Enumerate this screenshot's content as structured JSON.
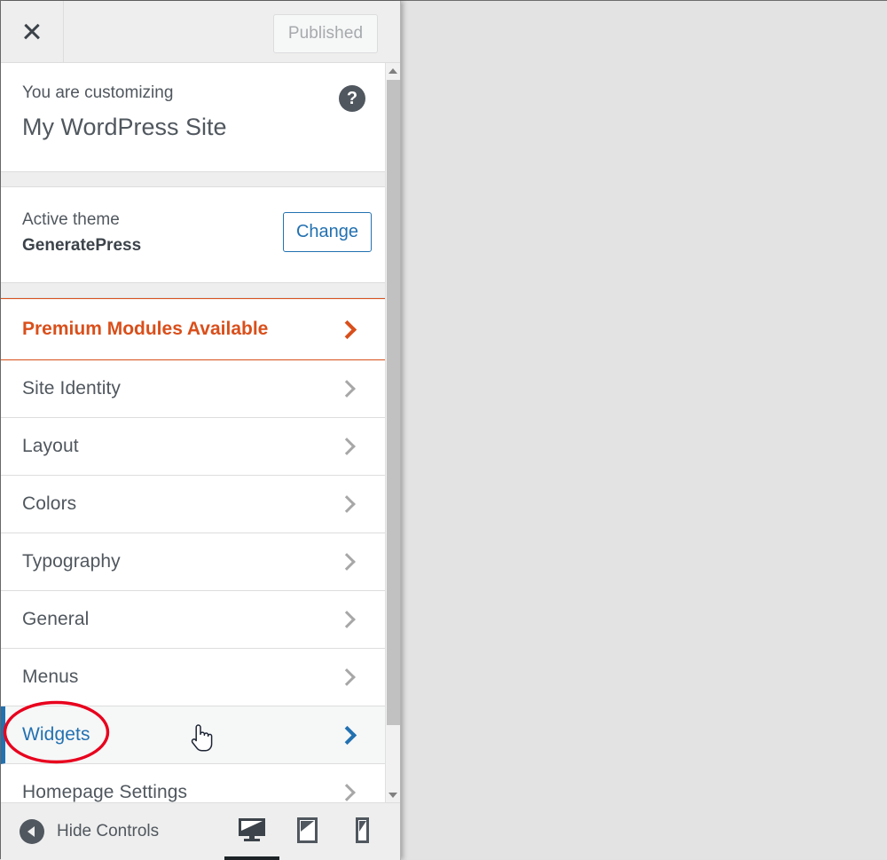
{
  "window": {
    "preview_background": "#e3e3e3"
  },
  "header": {
    "close_icon": "close-icon",
    "close_label": "Close Customizer",
    "publish_button_label": "Published"
  },
  "intro": {
    "eyebrow": "You are customizing",
    "site_title": "My WordPress Site",
    "help_icon": "help-icon",
    "help_glyph": "?"
  },
  "theme": {
    "label": "Active theme",
    "name": "GeneratePress",
    "change_button_label": "Change"
  },
  "promo": {
    "label": "Premium Modules Available",
    "accent_color": "#d94f1b",
    "chevron_icon": "chevron-right-icon"
  },
  "sections": [
    {
      "label": "Site Identity",
      "state": "default",
      "chevron_icon": "chevron-right-icon"
    },
    {
      "label": "Layout",
      "state": "default",
      "chevron_icon": "chevron-right-icon"
    },
    {
      "label": "Colors",
      "state": "default",
      "chevron_icon": "chevron-right-icon"
    },
    {
      "label": "Typography",
      "state": "default",
      "chevron_icon": "chevron-right-icon"
    },
    {
      "label": "General",
      "state": "default",
      "chevron_icon": "chevron-right-icon"
    },
    {
      "label": "Menus",
      "state": "default",
      "chevron_icon": "chevron-right-icon"
    },
    {
      "label": "Widgets",
      "state": "hovered",
      "chevron_icon": "chevron-right-icon"
    },
    {
      "label": "Homepage Settings",
      "state": "default",
      "chevron_icon": "chevron-right-icon"
    }
  ],
  "scrollbar": {
    "up_arrow_icon": "scroll-up-arrow-icon",
    "down_arrow_icon": "scroll-down-arrow-icon",
    "thumb_color": "#c1c1c1"
  },
  "footer": {
    "collapse_icon": "collapse-arrow-icon",
    "hide_controls_label": "Hide Controls",
    "devices": [
      {
        "name": "desktop",
        "icon": "desktop-icon",
        "active": true
      },
      {
        "name": "tablet",
        "icon": "tablet-icon",
        "active": false
      },
      {
        "name": "mobile",
        "icon": "mobile-icon",
        "active": false
      }
    ]
  },
  "annotation": {
    "shape": "ellipse",
    "color": "#e8001d",
    "target": "Widgets",
    "cursor_icon": "pointer-hand-cursor"
  },
  "colors": {
    "accent_blue": "#2271b1",
    "promo_orange": "#d94f1b",
    "annotation_red": "#e8001d",
    "panel_background": "#ffffff",
    "chrome_background": "#eeeeee"
  }
}
